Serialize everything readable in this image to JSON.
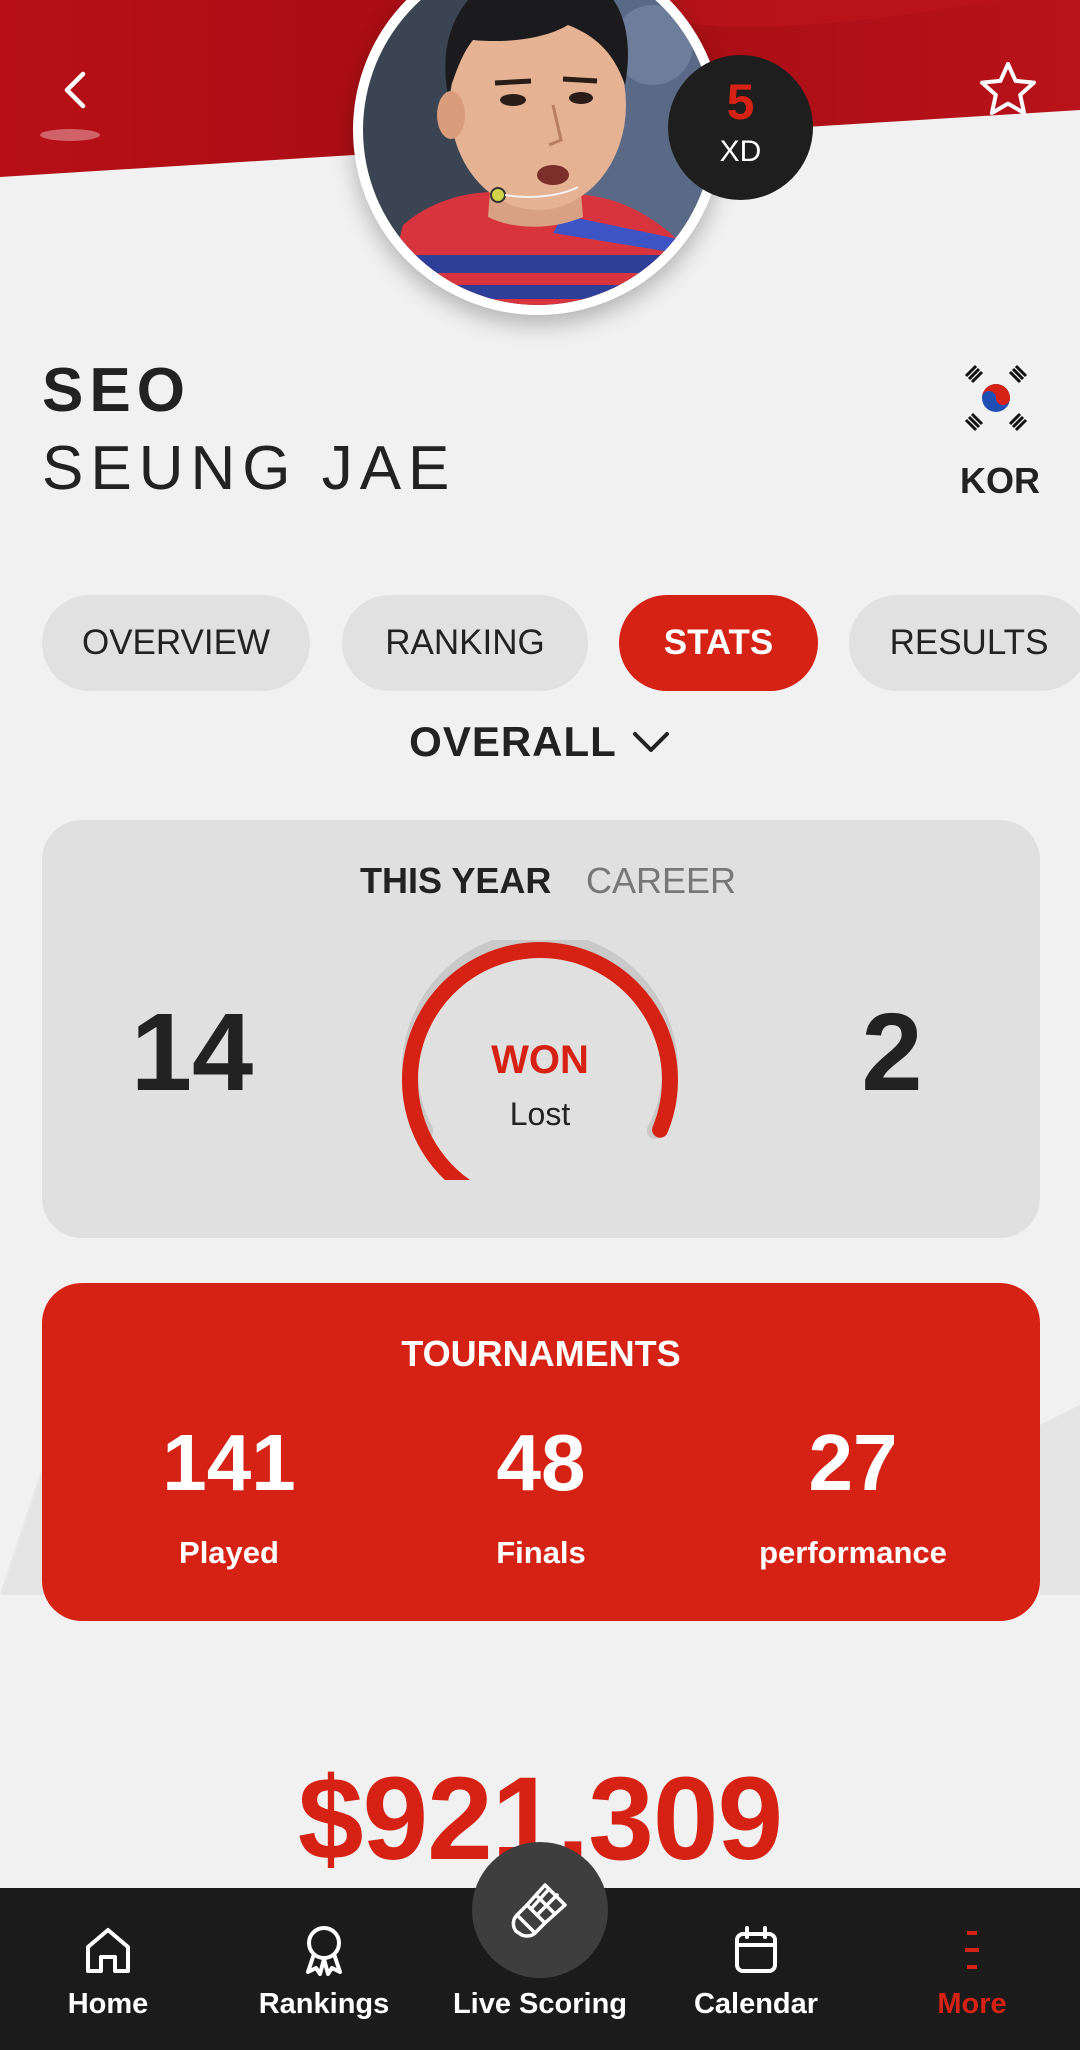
{
  "header": {
    "back_icon": "chevron-left-icon",
    "favorite_icon": "star-outline-icon",
    "accent_color": "#d62214"
  },
  "player": {
    "first_name": "SEO",
    "last_name": "SEUNG JAE",
    "country_code": "KOR",
    "flag": "south-korea-flag",
    "rank": "5",
    "category": "XD"
  },
  "tabs": [
    {
      "label": "OVERVIEW",
      "active": false
    },
    {
      "label": "RANKING",
      "active": false
    },
    {
      "label": "STATS",
      "active": true
    },
    {
      "label": "RESULTS",
      "active": false
    }
  ],
  "filter": {
    "label": "OVERALL",
    "icon": "chevron-down-icon"
  },
  "stats": {
    "segments": [
      {
        "label": "THIS YEAR",
        "active": true
      },
      {
        "label": "CAREER",
        "active": false
      }
    ],
    "won": 14,
    "lost": 2,
    "won_label": "WON",
    "lost_label": "Lost"
  },
  "tournaments": {
    "title": "TOURNAMENTS",
    "items": [
      {
        "value": "141",
        "label": "Played"
      },
      {
        "value": "48",
        "label": "Finals"
      },
      {
        "value": "27",
        "label": "performance"
      }
    ]
  },
  "prize_money": "$921,309",
  "bottom_nav": {
    "items": [
      {
        "label": "Home",
        "icon": "home-icon",
        "active": false
      },
      {
        "label": "Rankings",
        "icon": "award-ribbon-icon",
        "active": false
      },
      {
        "label": "Live Scoring",
        "icon": "shuttlecock-icon",
        "active": false
      },
      {
        "label": "Calendar",
        "icon": "calendar-icon",
        "active": false
      },
      {
        "label": "More",
        "icon": "more-menu-icon",
        "active": true
      }
    ]
  }
}
